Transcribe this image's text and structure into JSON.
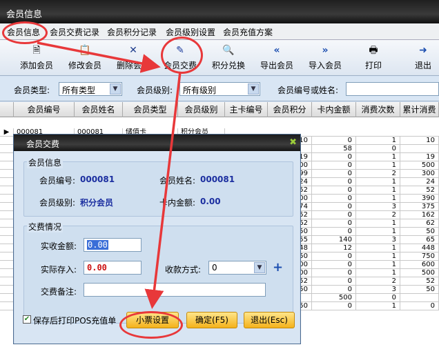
{
  "window": {
    "title": "会员信息"
  },
  "tabs": [
    "会员信息",
    "会员交费记录",
    "会员积分记录",
    "会员级别设置",
    "会员充值方案"
  ],
  "toolbar": {
    "add": "添加会员",
    "edit": "修改会员",
    "delete": "删除会员",
    "pay": "会员交费",
    "points": "积分兑换",
    "export": "导出会员",
    "import": "导入会员",
    "print": "打印",
    "exit": "退出"
  },
  "filters": {
    "type_label": "会员类型:",
    "type_value": "所有类型",
    "level_label": "会员级别:",
    "level_value": "所有级别",
    "search_label": "会员编号或姓名:"
  },
  "grid": {
    "headers": [
      "会员编号",
      "会员姓名",
      "会员类型",
      "会员级别",
      "主卡编号",
      "会员积分",
      "卡内金额",
      "消费次数",
      "累计消费"
    ],
    "first_row": [
      "000081",
      "000081",
      "储值卡",
      "积分会员"
    ],
    "rows": [
      [
        "10",
        "0",
        "1",
        "10"
      ],
      [
        "",
        "58",
        "0",
        ""
      ],
      [
        "19",
        "0",
        "1",
        "19"
      ],
      [
        "00",
        "0",
        "1",
        "500"
      ],
      [
        "99",
        "0",
        "2",
        "300"
      ],
      [
        "24",
        "0",
        "1",
        "24"
      ],
      [
        "52",
        "0",
        "1",
        "52"
      ],
      [
        "00",
        "0",
        "1",
        "390"
      ],
      [
        "74",
        "0",
        "3",
        "375"
      ],
      [
        "52",
        "0",
        "2",
        "162"
      ],
      [
        "62",
        "0",
        "1",
        "62"
      ],
      [
        "50",
        "0",
        "1",
        "50"
      ],
      [
        "55",
        "140",
        "3",
        "65"
      ],
      [
        "48",
        "12",
        "1",
        "448"
      ],
      [
        "50",
        "0",
        "1",
        "750"
      ],
      [
        "00",
        "0",
        "1",
        "600"
      ],
      [
        "00",
        "0",
        "1",
        "500"
      ],
      [
        "52",
        "0",
        "2",
        "52"
      ],
      [
        "50",
        "0",
        "3",
        "50"
      ],
      [
        "",
        "500",
        "0",
        ""
      ],
      [
        "50",
        "0",
        "1",
        "0"
      ]
    ]
  },
  "dialog": {
    "title": "会员交费",
    "member_group": "会员信息",
    "member_no_label": "会员编号:",
    "member_no": "000081",
    "member_name_label": "会员姓名:",
    "member_name": "000081",
    "member_level_label": "会员级别:",
    "member_level": "积分会员",
    "card_amount_label": "卡内金额:",
    "card_amount": "0.00",
    "pay_group": "交费情况",
    "received_label": "实收金额:",
    "received": "0.00",
    "deposit_label": "实际存入:",
    "deposit": "0.00",
    "method_label": "收款方式:",
    "method": "0",
    "note_label": "交费备注:",
    "print_checkbox": "保存后打印POS充值单",
    "receipt_btn": "小票设置",
    "ok_btn": "确定(F5)",
    "exit_btn": "退出(Esc)"
  },
  "colors": {
    "annotation": "#e8383a",
    "value_blue": "#1c2fa0",
    "input_red": "#cc1111",
    "button_gold": "#f4b21b"
  }
}
